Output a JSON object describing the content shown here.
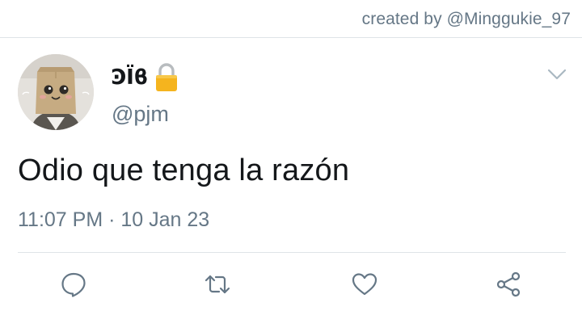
{
  "credit": "created by @Minggukie_97",
  "tweet": {
    "display_name": "ϿΪϐ",
    "handle": "@pjm",
    "text": "Odio que tenga la razón",
    "timestamp": "11:07 PM · 10 Jan 23",
    "protected": true
  },
  "icons": {
    "lock": "lock-icon",
    "menu": "chevron-down-icon",
    "reply": "reply-icon",
    "retweet": "retweet-icon",
    "like": "heart-icon",
    "share": "share-icon"
  },
  "colors": {
    "text_primary": "#14171a",
    "text_secondary": "#657786",
    "divider": "#dfe4e8",
    "lock_body": "#f5b41e"
  }
}
